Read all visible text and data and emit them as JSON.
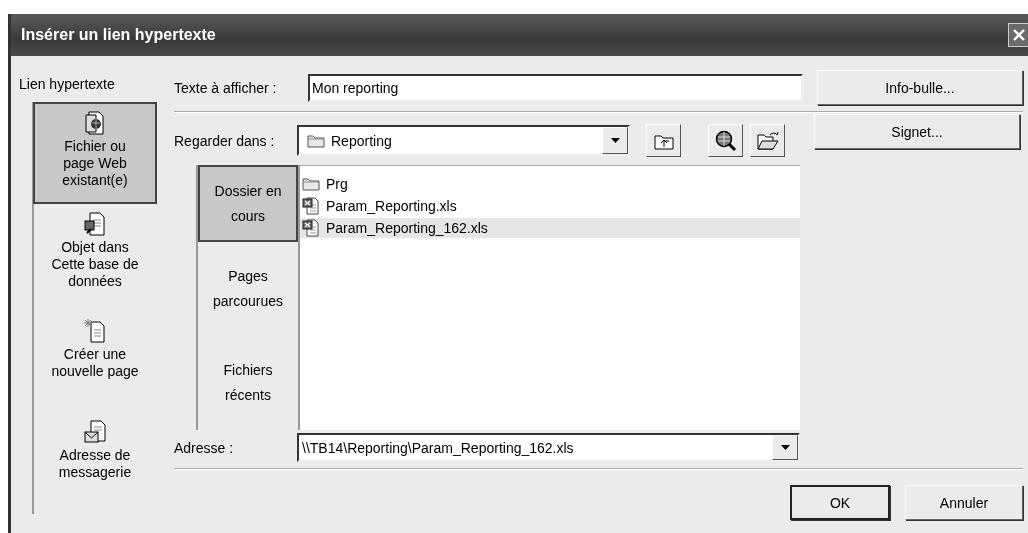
{
  "window": {
    "title": "Insérer un lien hypertexte"
  },
  "link_to": {
    "label": "Lien hypertexte",
    "items": [
      {
        "label": "Fichier ou\npage Web\nexistant(e)",
        "kind": "file",
        "selected": true
      },
      {
        "label": "Objet dans\nCette base de\ndonnées",
        "kind": "database",
        "selected": false
      },
      {
        "label": "Créer une\nnouvelle page",
        "kind": "new-page",
        "selected": false
      },
      {
        "label": "Adresse de\nmessagerie",
        "kind": "email",
        "selected": false
      }
    ]
  },
  "text_to_display": {
    "label": "Texte à afficher :",
    "value": "Mon reporting"
  },
  "look_in": {
    "label": "Regarder dans :",
    "value": "Reporting"
  },
  "places": [
    {
      "label": "Dossier en\ncours",
      "selected": true
    },
    {
      "label": "Pages\nparcourues",
      "selected": false
    },
    {
      "label": "Fichiers\nrécents",
      "selected": false
    }
  ],
  "files": [
    {
      "name": "Prg",
      "kind": "folder",
      "selected": false
    },
    {
      "name": "Param_Reporting.xls",
      "kind": "spreadsheet",
      "selected": false
    },
    {
      "name": "Param_Reporting_162.xls",
      "kind": "spreadsheet",
      "selected": true
    }
  ],
  "address": {
    "label": "Adresse :",
    "value": "\\\\TB14\\Reporting\\Param_Reporting_162.xls"
  },
  "side_buttons": [
    "Info-bulle...",
    "Signet..."
  ],
  "buttons": [
    {
      "label": "OK",
      "default": true
    },
    {
      "label": "Annuler",
      "default": false
    }
  ]
}
